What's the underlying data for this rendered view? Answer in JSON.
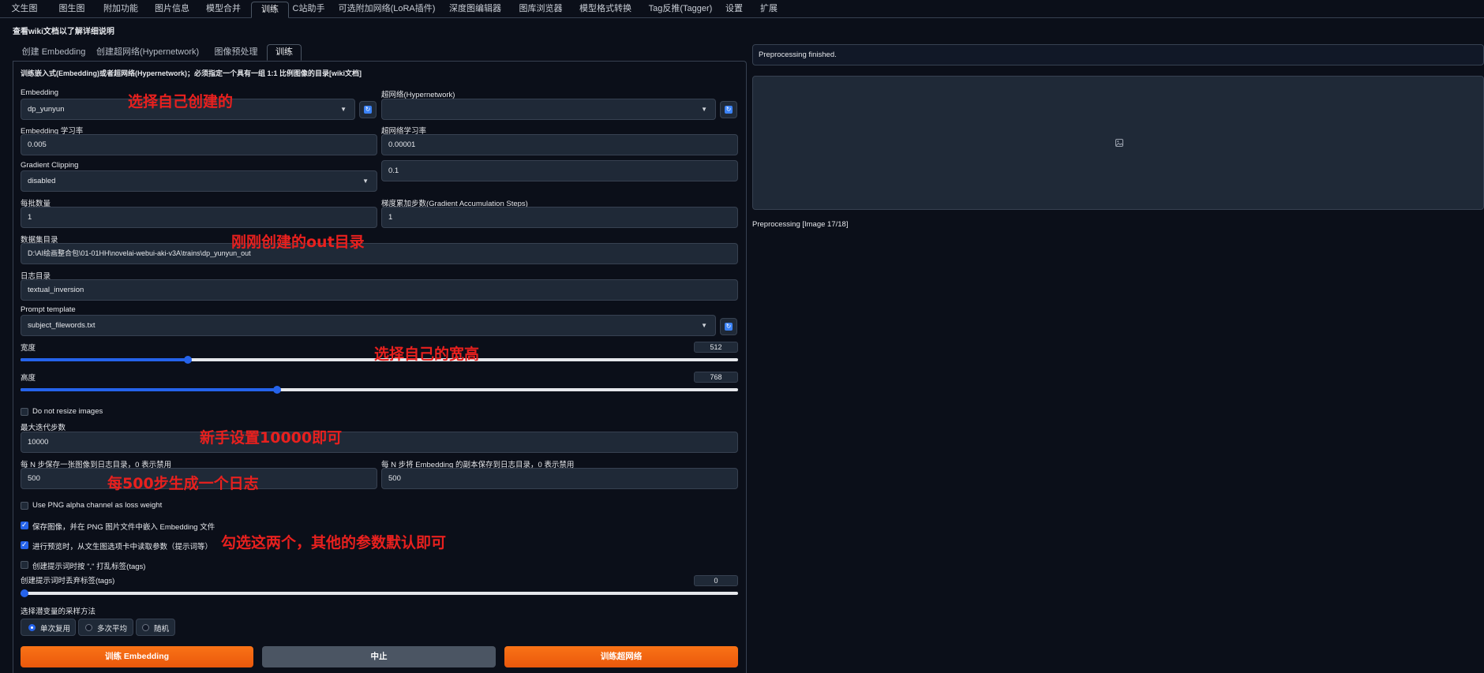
{
  "top_tabs": [
    "文生图",
    "图生图",
    "附加功能",
    "图片信息",
    "模型合并",
    "训练",
    "C站助手",
    "可选附加网络(LoRA插件)",
    "深度图编辑器",
    "图库浏览器",
    "模型格式转换",
    "Tag反推(Tagger)",
    "设置",
    "扩展"
  ],
  "active_top_tab": "训练",
  "wiki_notice": "查看wiki文档以了解详细说明",
  "sub_tabs": [
    "创建 Embedding",
    "创建超网络(Hypernetwork)",
    "图像预处理",
    "训练"
  ],
  "description": "训练嵌入式(Embedding)或者超网络(Hypernetwork)；必须指定一个具有一组 1:1 比例图像的目录[wiki文档]",
  "embedding": {
    "label": "Embedding",
    "value": "dp_yunyun"
  },
  "hypernetwork": {
    "label": "超网络(Hypernetwork)",
    "value": ""
  },
  "embedding_lr": {
    "label": "Embedding 学习率",
    "value": "0.005"
  },
  "hypernetwork_lr": {
    "label": "超网络学习率",
    "value": "0.00001"
  },
  "gradient_clipping": {
    "label": "Gradient Clipping",
    "value": "disabled",
    "clip_value": "0.1"
  },
  "batch_size": {
    "label": "每批数量",
    "value": "1"
  },
  "grad_accum": {
    "label": "梯度累加步数(Gradient Accumulation Steps)",
    "value": "1"
  },
  "dataset_dir": {
    "label": "数据集目录",
    "value": "D:\\AI绘画整合包\\01-01HH\\novelai-webui-aki-v3A\\trains\\dp_yunyun_out"
  },
  "log_dir": {
    "label": "日志目录",
    "value": "textual_inversion"
  },
  "prompt_template": {
    "label": "Prompt template",
    "value": "subject_filewords.txt"
  },
  "width": {
    "label": "宽度",
    "value": "512",
    "fraction": 0.233
  },
  "height": {
    "label": "高度",
    "value": "768",
    "fraction": 0.358
  },
  "do_not_resize": {
    "label": "Do not resize images",
    "checked": false
  },
  "max_steps": {
    "label": "最大迭代步数",
    "value": "10000"
  },
  "save_image_every": {
    "label": "每 N 步保存一张图像到日志目录，0 表示禁用",
    "value": "500"
  },
  "save_embedding_every": {
    "label": "每 N 步将 Embedding 的副本保存到日志目录，0 表示禁用",
    "value": "500"
  },
  "use_png_alpha": {
    "label": "Use PNG alpha channel as loss weight",
    "checked": false
  },
  "save_image_with_embedding": {
    "label": "保存图像，并在 PNG 图片文件中嵌入 Embedding 文件",
    "checked": true
  },
  "read_params_from_txt2img": {
    "label": "进行预览时，从文生图选项卡中读取参数（提示词等）",
    "checked": true
  },
  "shuffle_tags": {
    "label": "创建提示词时按 \",\" 打乱标签(tags)",
    "checked": false
  },
  "drop_tags": {
    "label": "创建提示词时丢弃标签(tags)",
    "value": "0",
    "fraction": 0.0
  },
  "latent_sampling": {
    "label": "选择潜变量的采样方法",
    "options": [
      "单次复用",
      "多次平均",
      "随机"
    ],
    "selected": "单次复用"
  },
  "buttons": {
    "train_embedding": "训练 Embedding",
    "interrupt": "中止",
    "train_hypernetwork": "训练超网络"
  },
  "right": {
    "status": "Preprocessing finished.",
    "progress": "Preprocessing [Image 17/18]"
  },
  "annotations": {
    "a1": "选择自己创建的",
    "a2": "刚刚创建的out目录",
    "a3": "选择自己的宽高",
    "a4": "新手设置10000即可",
    "a5": "每500步生成一个日志",
    "a6": "勾选这两个，其他的参数默认即可"
  },
  "colors": {
    "background": "#0b0f19",
    "accent": "#2563eb",
    "button_orange": "#f97316",
    "annotation": "#e8201e"
  }
}
